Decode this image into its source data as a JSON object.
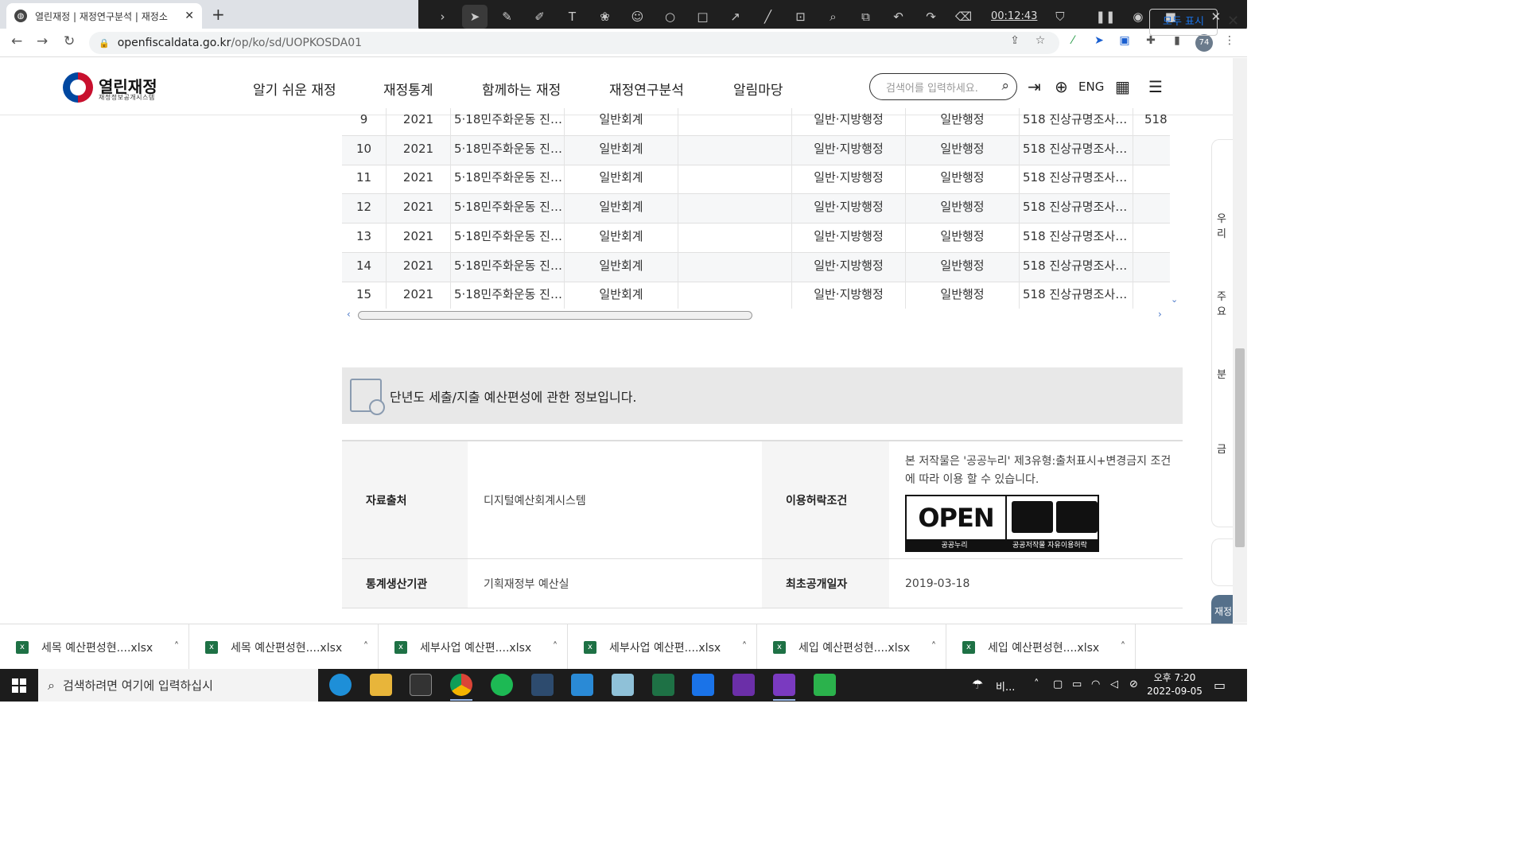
{
  "browser": {
    "tab_title": "열린재정 | 재정연구분석 | 재정소",
    "url_domain": "openfiscaldata.go.kr",
    "url_path": "/op/ko/sd/UOPKOSDA01",
    "profile_badge": "74"
  },
  "recorder": {
    "timer": "00:12:43"
  },
  "site": {
    "logo_title": "열린재정",
    "logo_subtitle": "재정정보공개시스템",
    "nav": [
      "알기 쉬운 재정",
      "재정통계",
      "함께하는 재정",
      "재정연구분석",
      "알림마당"
    ],
    "search_placeholder": "검색어를 입력하세요.",
    "lang_label": "ENG"
  },
  "table": {
    "rows": [
      [
        "9",
        "2021",
        "5·18민주화운동 진…",
        "일반회계",
        "",
        "일반·지방행정",
        "일반행정",
        "518 진상규명조사…",
        "518 ?"
      ],
      [
        "10",
        "2021",
        "5·18민주화운동 진…",
        "일반회계",
        "",
        "일반·지방행정",
        "일반행정",
        "518 진상규명조사…",
        ""
      ],
      [
        "11",
        "2021",
        "5·18민주화운동 진…",
        "일반회계",
        "",
        "일반·지방행정",
        "일반행정",
        "518 진상규명조사…",
        ""
      ],
      [
        "12",
        "2021",
        "5·18민주화운동 진…",
        "일반회계",
        "",
        "일반·지방행정",
        "일반행정",
        "518 진상규명조사…",
        ""
      ],
      [
        "13",
        "2021",
        "5·18민주화운동 진…",
        "일반회계",
        "",
        "일반·지방행정",
        "일반행정",
        "518 진상규명조사…",
        ""
      ],
      [
        "14",
        "2021",
        "5·18민주화운동 진…",
        "일반회계",
        "",
        "일반·지방행정",
        "일반행정",
        "518 진상규명조사…",
        ""
      ],
      [
        "15",
        "2021",
        "5·18민주화운동 진…",
        "일반회계",
        "",
        "일반·지방행정",
        "일반행정",
        "518 진상규명조사…",
        ""
      ]
    ]
  },
  "info": {
    "banner": "단년도 세출/지출 예산편성에 관한 정보입니다.",
    "source_label": "자료출처",
    "source_value": "디지털예산회계시스템",
    "license_label": "이용허락조건",
    "license_text": "본 저작물은 '공공누리' 제3유형:출처표시+변경금지 조건에 따라 이용 할 수 있습니다.",
    "kogl_open": "OPEN",
    "kogl_foot_left": "공공누리",
    "kogl_foot_right": "공공저작물 자유이용허락",
    "kogl_sign1": "출처표시",
    "kogl_sign2": "변경금지",
    "producer_label": "통계생산기관",
    "producer_value": "기획재정부 예산실",
    "date_label": "최초공개일자",
    "date_value": "2019-03-18"
  },
  "side_panel": {
    "labels": [
      "우리",
      "주요",
      "분",
      "금",
      "재정"
    ]
  },
  "downloads": {
    "items": [
      "세목 예산편성현....xlsx",
      "세목 예산편성현....xlsx",
      "세부사업 예산편....xlsx",
      "세부사업 예산편....xlsx",
      "세입 예산편성현....xlsx",
      "세입 예산편성현....xlsx"
    ],
    "show_all": "모두 표시"
  },
  "taskbar": {
    "search_placeholder": "검색하려면 여기에 입력하십시",
    "weather": "비...",
    "time": "오후 7:20",
    "date": "2022-09-05"
  },
  "colors": {
    "accent_blue": "#1a73e8",
    "table_alt_row": "#f6f7f8",
    "banner_bg": "#e8e8e8",
    "excel_green": "#1e7145"
  }
}
